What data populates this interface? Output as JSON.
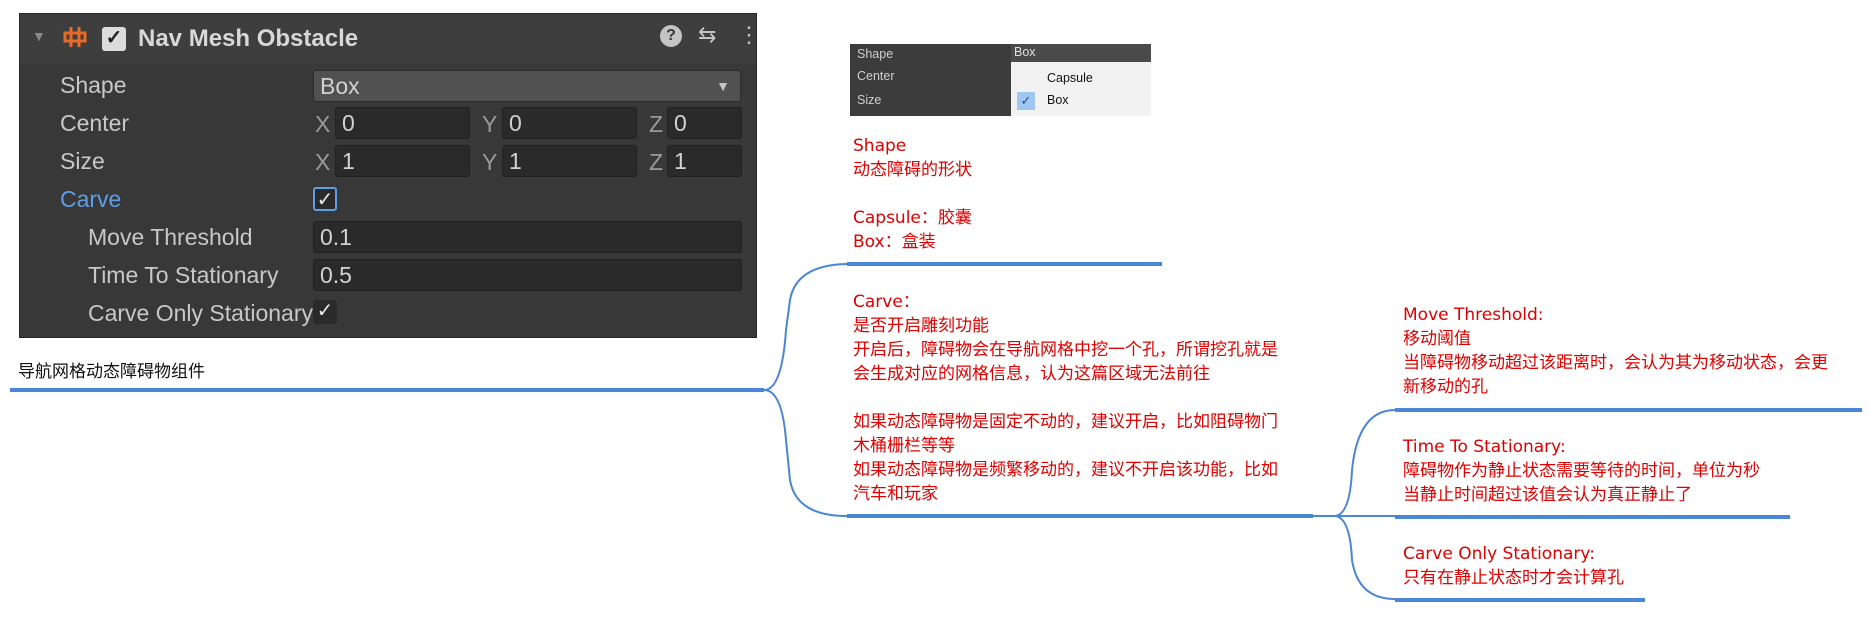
{
  "inspector": {
    "title": "Nav Mesh Obstacle",
    "shape_label": "Shape",
    "shape_value": "Box",
    "center_label": "Center",
    "center": {
      "x": "0",
      "y": "0",
      "z": "0"
    },
    "size_label": "Size",
    "size": {
      "x": "1",
      "y": "1",
      "z": "1"
    },
    "axis_x": "X",
    "axis_y": "Y",
    "axis_z": "Z",
    "carve_label": "Carve",
    "move_threshold_label": "Move Threshold",
    "move_threshold_value": "0.1",
    "time_to_stationary_label": "Time To Stationary",
    "time_to_stationary_value": "0.5",
    "carve_only_stationary_label": "Carve Only Stationary",
    "check": "✓"
  },
  "mini_dropdown": {
    "shape_label": "Shape",
    "center_label": "Center",
    "size_label": "Size",
    "selected": "Box",
    "options": [
      "Capsule",
      "Box"
    ]
  },
  "root_label": "导航网格动态障碍物组件",
  "notes": {
    "shape": [
      "Shape",
      "动态障碍的形状",
      "",
      "Capsule：胶囊",
      "Box：盒装"
    ],
    "carve": [
      "Carve：",
      "是否开启雕刻功能",
      "开启后，障碍物会在导航网格中挖一个孔，所谓挖孔就是",
      "会生成对应的网格信息，认为这篇区域无法前往",
      "",
      "如果动态障碍物是固定不动的，建议开启，比如阻碍物门",
      "木桶栅栏等等",
      "如果动态障碍物是频繁移动的，建议不开启该功能，比如",
      "汽车和玩家"
    ],
    "move_threshold": [
      "Move Threshold:",
      "移动阈值",
      "当障碍物移动超过该距离时，会认为其为移动状态，会更",
      "新移动的孔"
    ],
    "time_to_stationary": [
      "Time To Stationary:",
      "障碍物作为静止状态需要等待的时间，单位为秒",
      "当静止时间超过该值会认为真正静止了"
    ],
    "carve_only_stationary": [
      "Carve Only Stationary:",
      "只有在静止状态时才会计算孔"
    ]
  },
  "colors": {
    "line": "#4a86d6",
    "note_text": "#e00000",
    "panel": "#383838",
    "accent_label": "#5e9ee8"
  }
}
